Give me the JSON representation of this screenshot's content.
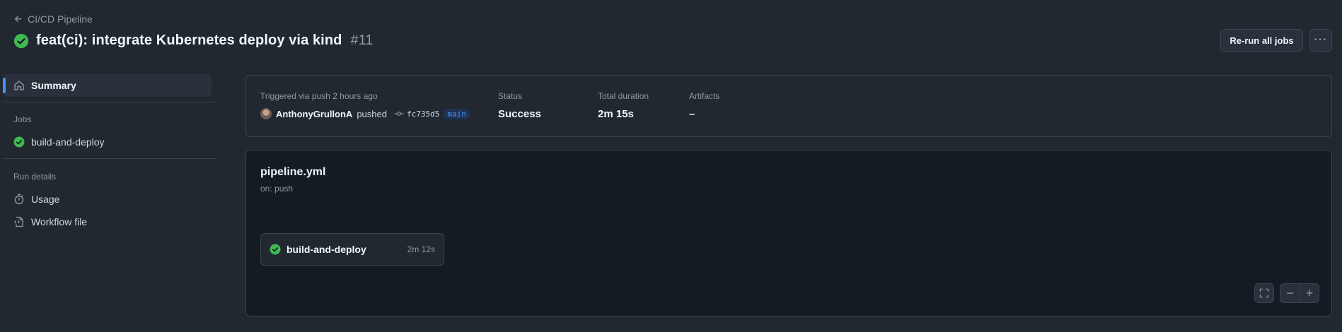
{
  "header": {
    "back_label": "CI/CD Pipeline",
    "run_title": "feat(ci): integrate Kubernetes deploy via kind",
    "run_number": "#11",
    "rerun_label": "Re-run all jobs",
    "more_label": "···"
  },
  "sidebar": {
    "summary_label": "Summary",
    "jobs_heading": "Jobs",
    "job_label": "build-and-deploy",
    "run_details_heading": "Run details",
    "usage_label": "Usage",
    "workflow_file_label": "Workflow file"
  },
  "summary": {
    "trigger_label": "Triggered via push 2 hours ago",
    "actor": "AnthonyGrullonA",
    "action": "pushed",
    "commit": "fc735d5",
    "branch": "main",
    "status_label": "Status",
    "status_value": "Success",
    "duration_label": "Total duration",
    "duration_value": "2m 15s",
    "artifacts_label": "Artifacts",
    "artifacts_value": "–"
  },
  "graph": {
    "workflow_name": "pipeline.yml",
    "trigger": "on: push",
    "job_name": "build-and-deploy",
    "job_duration": "2m 12s",
    "zoom_out": "−",
    "zoom_in": "+"
  },
  "colors": {
    "success": "#3fb950",
    "accent": "#4493f8",
    "background": "#212830",
    "panel": "#151b23"
  }
}
